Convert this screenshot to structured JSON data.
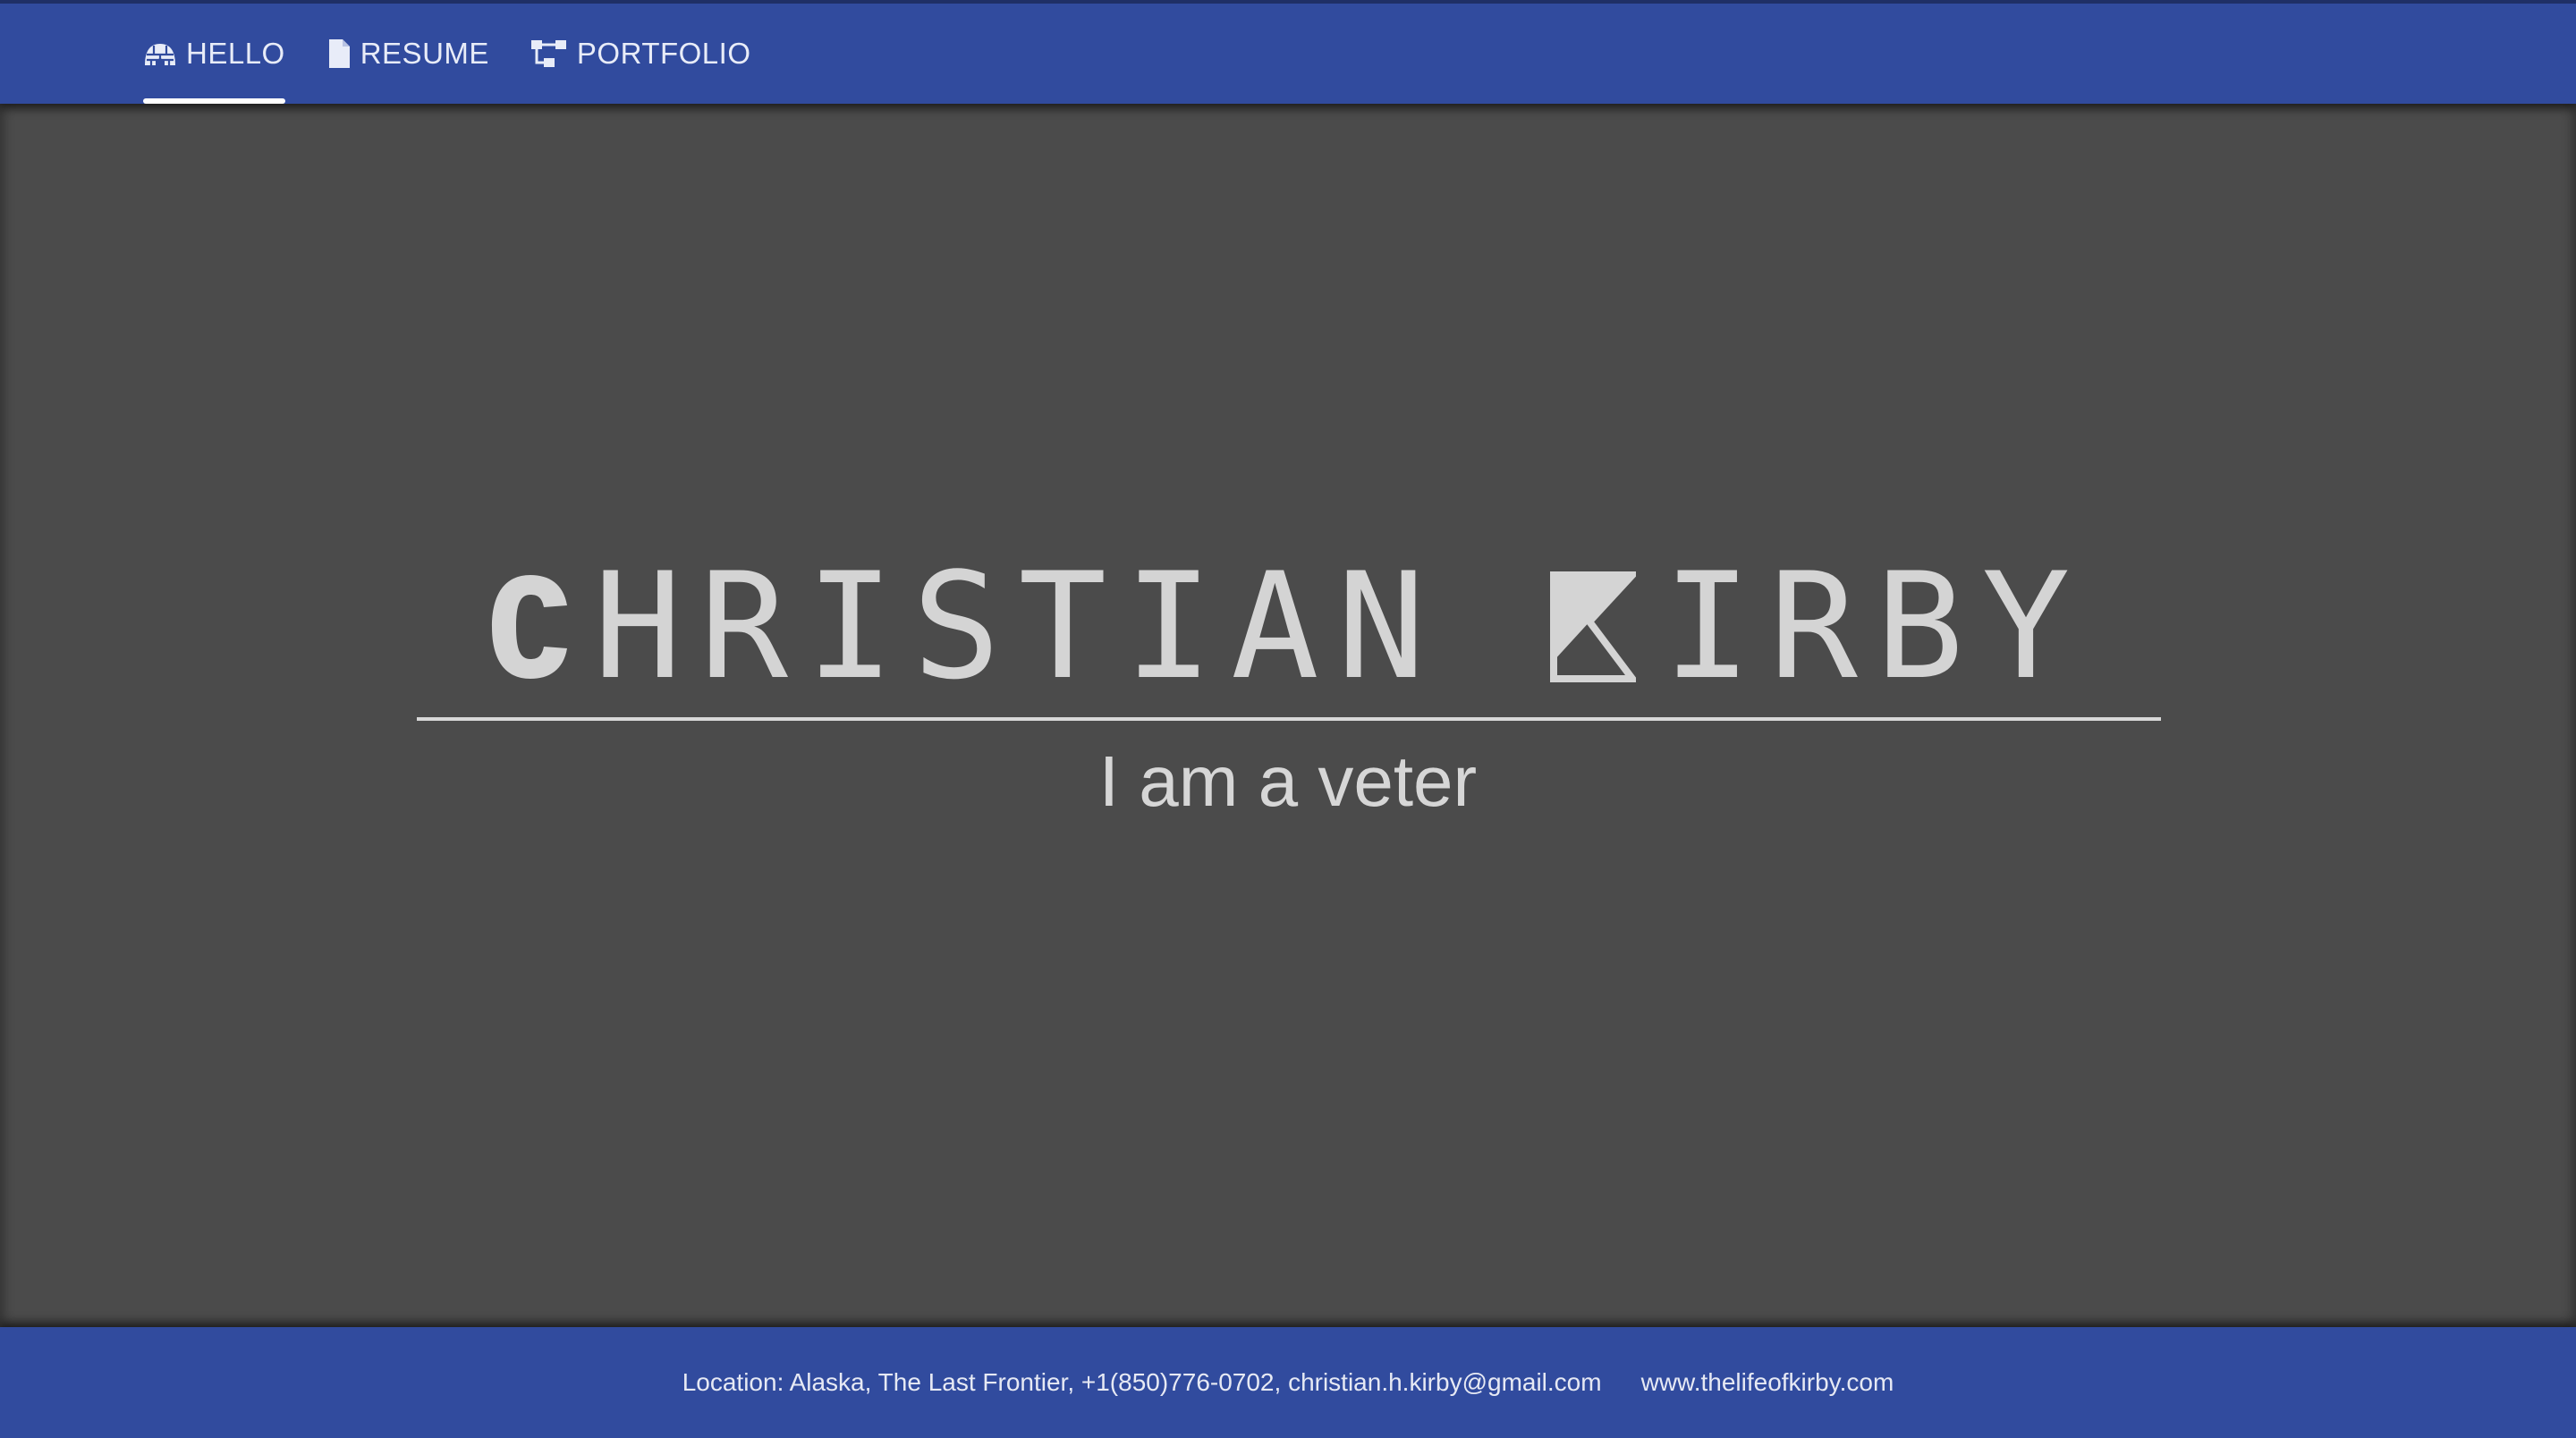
{
  "nav": {
    "items": [
      {
        "label": "HELLO",
        "icon": "igloo-icon",
        "active": true
      },
      {
        "label": "RESUME",
        "icon": "file-icon",
        "active": false
      },
      {
        "label": "PORTFOLIO",
        "icon": "sitemap-icon",
        "active": false
      }
    ]
  },
  "hero": {
    "first_name_rest": "HRISTIAN",
    "last_name_rest": "IRBY",
    "tagline": "I am a veter"
  },
  "footer": {
    "contact": "Location: Alaska, The Last Frontier, +1(850)776-0702, christian.h.kirby@gmail.com",
    "website": "www.thelifeofkirby.com"
  },
  "colors": {
    "nav_bg": "#314b9e",
    "page_bg": "#4b4b4b",
    "text_light": "#d4d4d4"
  }
}
